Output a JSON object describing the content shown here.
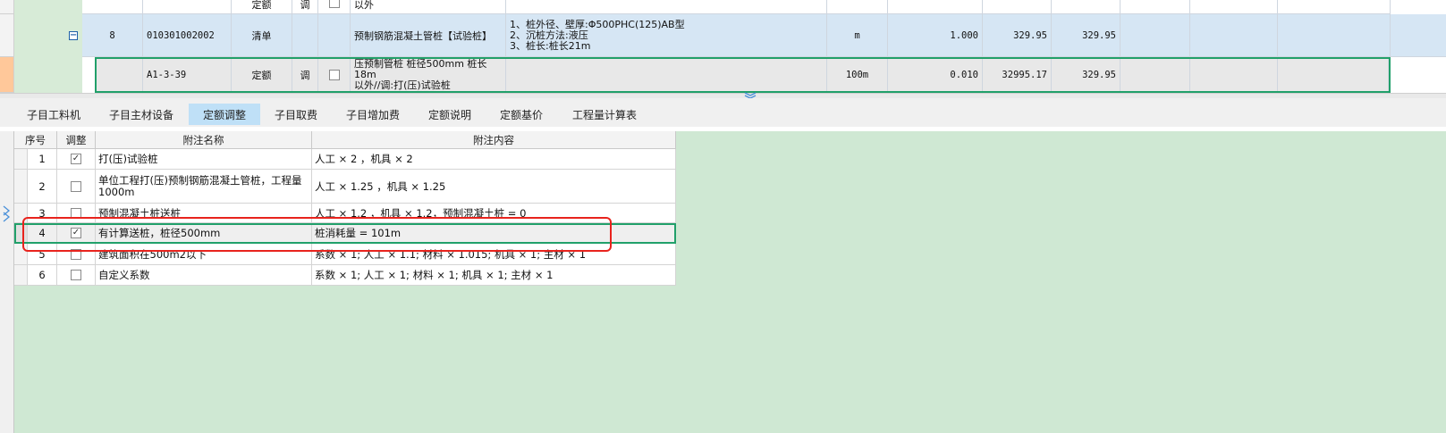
{
  "upper_rows": [
    {
      "col_code": "",
      "col_type": "定额",
      "col_adj": "调",
      "col_name": "以外",
      "col_feature": "",
      "col_unit": "",
      "col_qty": "",
      "col_price": "",
      "col_total": ""
    },
    {
      "col_seq": "8",
      "col_code": "010301002002",
      "col_type": "清单",
      "col_name": "预制钢筋混凝土管桩【试验桩】",
      "col_feature": "1、桩外径、壁厚:Φ500PHC(125)AB型\n2、沉桩方法:液压\n3、桩长:桩长21m",
      "col_unit": "m",
      "col_qty": "1.000",
      "col_price": "329.95",
      "col_total": "329.95"
    },
    {
      "col_code": "A1-3-39",
      "col_type": "定额",
      "col_adj": "调",
      "col_name": "压预制管桩 桩径500mm 桩长18m\n以外//调:打(压)试验桩",
      "col_feature": "",
      "col_unit": "100m",
      "col_qty": "0.010",
      "col_price": "32995.17",
      "col_total": "329.95"
    }
  ],
  "tabs": [
    {
      "label": "子目工料机",
      "active": false
    },
    {
      "label": "子目主材设备",
      "active": false
    },
    {
      "label": "定额调整",
      "active": true
    },
    {
      "label": "子目取费",
      "active": false
    },
    {
      "label": "子目增加费",
      "active": false
    },
    {
      "label": "定额说明",
      "active": false
    },
    {
      "label": "定额基价",
      "active": false
    },
    {
      "label": "工程量计算表",
      "active": false
    }
  ],
  "adjust_table": {
    "headers": {
      "seq": "序号",
      "adjust": "调整",
      "note_name": "附注名称",
      "note_content": "附注内容"
    },
    "rows": [
      {
        "seq": "1",
        "checked": true,
        "name": "打(压)试验桩",
        "content": "人工 × 2 ，机具 × 2"
      },
      {
        "seq": "2",
        "checked": false,
        "name": "单位工程打(压)预制钢筋混凝土管桩，工程量1000m",
        "content": "人工 × 1.25 ，机具 × 1.25"
      },
      {
        "seq": "3",
        "checked": false,
        "name": "预制混凝土桩送桩",
        "content": "人工 × 1.2 ，机具 × 1.2，预制混凝土桩 = 0"
      },
      {
        "seq": "4",
        "checked": true,
        "name": "有计算送桩，桩径500mm",
        "content": "桩消耗量 = 101m"
      },
      {
        "seq": "5",
        "checked": false,
        "name": "建筑面积在500m2以下",
        "content": "系数 × 1; 人工 × 1.1; 材料 × 1.015; 机具 × 1; 主材 × 1"
      },
      {
        "seq": "6",
        "checked": false,
        "name": "自定义系数",
        "content": "系数 × 1; 人工 × 1; 材料 × 1; 机具 × 1; 主材 × 1"
      }
    ]
  },
  "colors": {
    "selected_row_bg": "#d6e6f4",
    "current_row_border": "#21a06a",
    "bottom_bg": "#cfe8d3",
    "active_tab_bg": "#bfe0f7",
    "annotation_red": "#e8231d",
    "row_marker_orange": "#ffc89a"
  },
  "icons": {
    "expander": "collapse-minus-icon",
    "splitter_arrow": "chevron-double-down-icon",
    "side_arrow": "chevron-right-icon"
  }
}
